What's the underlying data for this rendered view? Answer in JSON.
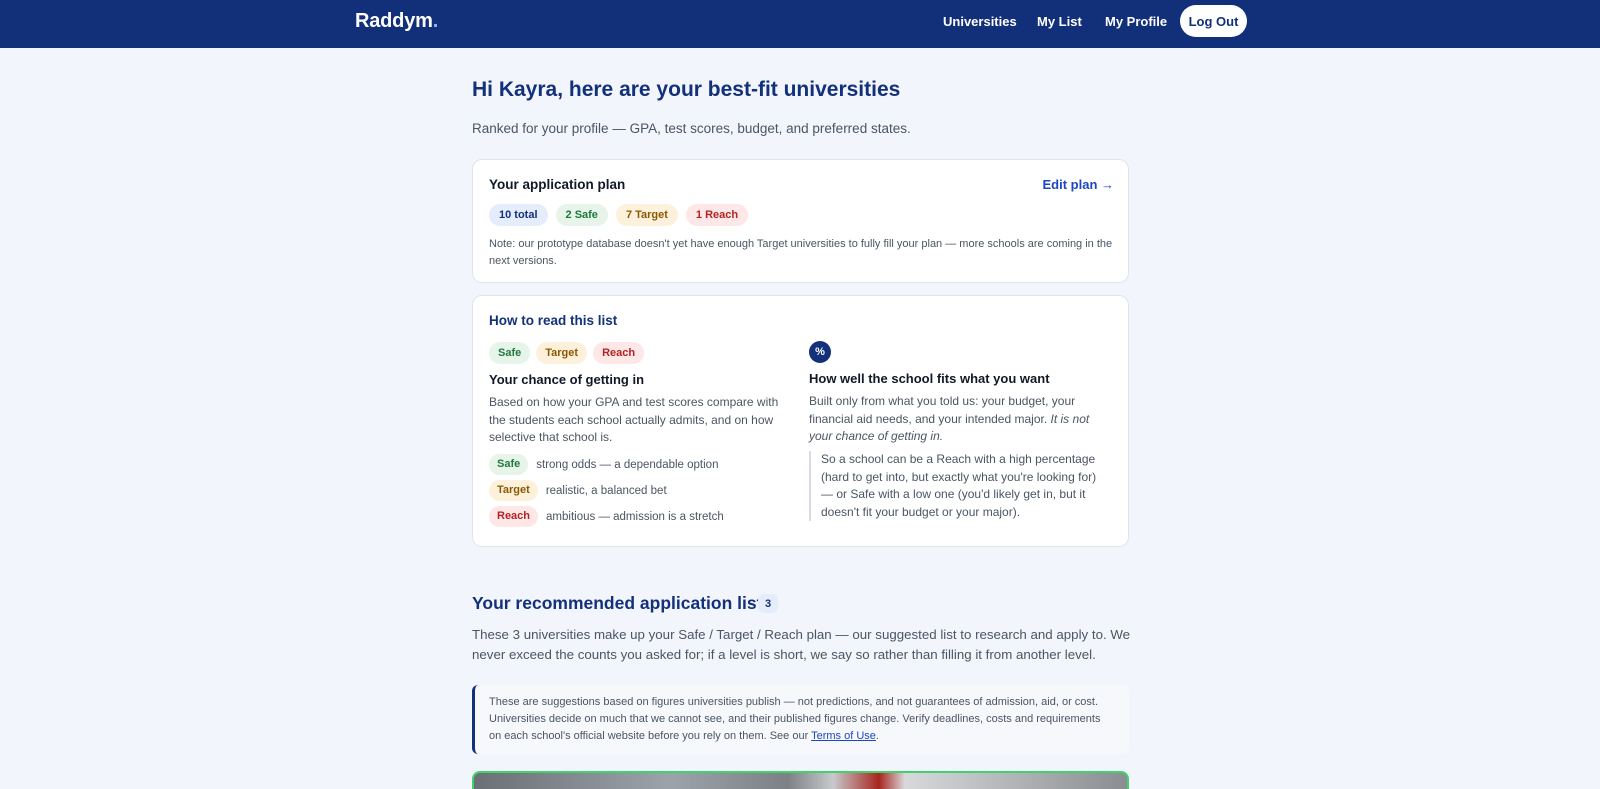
{
  "header": {
    "brand": "Raddym",
    "brand_dot": ".",
    "nav": {
      "universities": "Universities",
      "my_list": "My List",
      "my_profile": "My Profile",
      "logout": "Log Out"
    }
  },
  "page": {
    "title": "Hi Kayra, here are your best-fit universities",
    "subtitle": "Ranked for your profile — GPA, test scores, budget, and preferred states."
  },
  "plan": {
    "title": "Your application plan",
    "edit_label": "Edit plan →",
    "pills": {
      "total": "10 total",
      "safe": "2 Safe",
      "target": "7 Target",
      "reach": "1 Reach"
    },
    "note": "Note: our prototype database doesn't yet have enough Target universities to fully fill your plan — more schools are coming in the next versions."
  },
  "how_to_read": {
    "title": "How to read this list",
    "pills": {
      "safe": "Safe",
      "target": "Target",
      "reach": "Reach"
    },
    "chance": {
      "title": "Your chance of getting in",
      "body": "Based on how your GPA and test scores compare with the students each school actually admits, and on how selective that school is.",
      "legend": [
        {
          "label": "Safe",
          "text": "strong odds — a dependable option"
        },
        {
          "label": "Target",
          "text": "realistic, a balanced bet"
        },
        {
          "label": "Reach",
          "text": "ambitious — admission is a stretch"
        }
      ]
    },
    "fit": {
      "icon": "%",
      "title": "How well the school fits what you want",
      "body": "Built only from what you told us: your budget, your financial aid needs, and your intended major.",
      "body_emphasis": "It is not your chance of getting in.",
      "quote": "So a school can be a Reach with a high percentage (hard to get into, but exactly what you're looking for) — or Safe with a low one (you'd likely get in, but it doesn't fit your budget or your major)."
    }
  },
  "recommended": {
    "title": "Your recommended application list",
    "count": "3",
    "description": "These 3 universities make up your Safe / Target / Reach plan — our suggested list to research and apply to. We never exceed the counts you asked for; if a level is short, we say so rather than filling it from another level."
  },
  "disclaimer": {
    "text": "These are suggestions based on figures universities publish — not predictions, and not guarantees of admission, aid, or cost. Universities decide on much that we cannot see, and their published figures change. Verify deadlines, costs and requirements on each school's official website before you rely on them. See our",
    "link": "Terms of Use",
    "end": "."
  },
  "colors": {
    "header_bg": "#12307a",
    "accent": "#1d46c4",
    "safe": "#1f7a3b",
    "target": "#8a5a00",
    "reach": "#b42323",
    "highlight_border": "#3fd36a"
  }
}
